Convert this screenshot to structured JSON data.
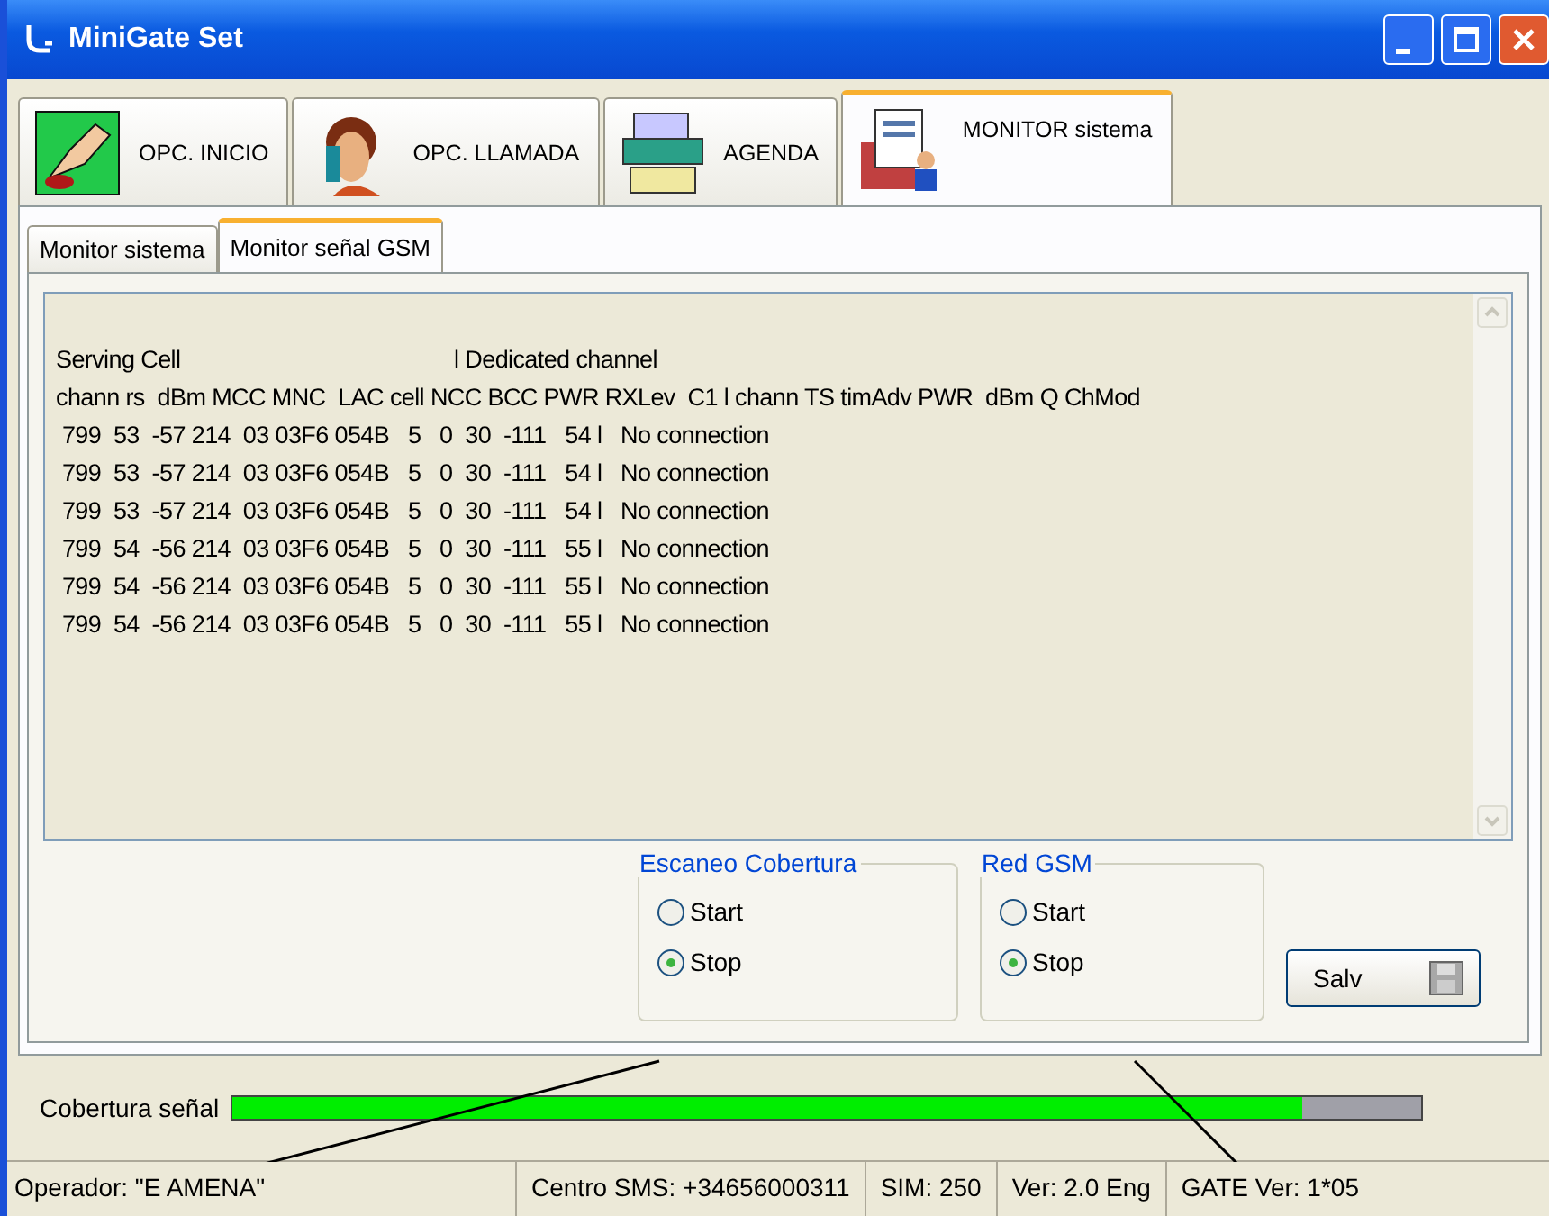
{
  "window": {
    "title": "MiniGate Set"
  },
  "main_tabs": [
    {
      "label": "OPC. INICIO",
      "selected": false,
      "kind": "hand"
    },
    {
      "label": "OPC. LLAMADA",
      "selected": false,
      "kind": "phone"
    },
    {
      "label": "AGENDA",
      "selected": false,
      "kind": "printer"
    },
    {
      "label": "MONITOR sistema",
      "selected": true,
      "kind": "monitor"
    }
  ],
  "sub_tabs": [
    {
      "label": "Monitor sistema",
      "selected": false
    },
    {
      "label": "Monitor señal GSM",
      "selected": true
    }
  ],
  "monitor_text": [
    "Serving Cell                                            l Dedicated channel",
    "chann rs  dBm MCC MNC  LAC cell NCC BCC PWR RXLev  C1 l chann TS timAdv PWR  dBm Q ChMod",
    " 799  53  -57 214  03 03F6 054B   5   0  30  -111   54 l   No connection",
    " 799  53  -57 214  03 03F6 054B   5   0  30  -111   54 l   No connection",
    " 799  53  -57 214  03 03F6 054B   5   0  30  -111   54 l   No connection",
    " 799  54  -56 214  03 03F6 054B   5   0  30  -111   55 l   No connection",
    " 799  54  -56 214  03 03F6 054B   5   0  30  -111   55 l   No connection",
    " 799  54  -56 214  03 03F6 054B   5   0  30  -111   55 l   No connection"
  ],
  "groups": [
    {
      "title": "Escaneo Cobertura",
      "options": [
        {
          "label": "Start",
          "selected": false
        },
        {
          "label": "Stop",
          "selected": true
        }
      ]
    },
    {
      "title": "Red GSM",
      "options": [
        {
          "label": "Start",
          "selected": false
        },
        {
          "label": "Stop",
          "selected": true
        }
      ]
    }
  ],
  "save_button": {
    "label": "Salv"
  },
  "coverage": {
    "label": "Cobertura señal",
    "level": 0.9
  },
  "status_bar": [
    "Operador: \"E AMENA\"",
    "Centro SMS:  +34656000311",
    "SIM: 250",
    "Ver: 2.0  Eng",
    "GATE Ver: 1*05"
  ]
}
